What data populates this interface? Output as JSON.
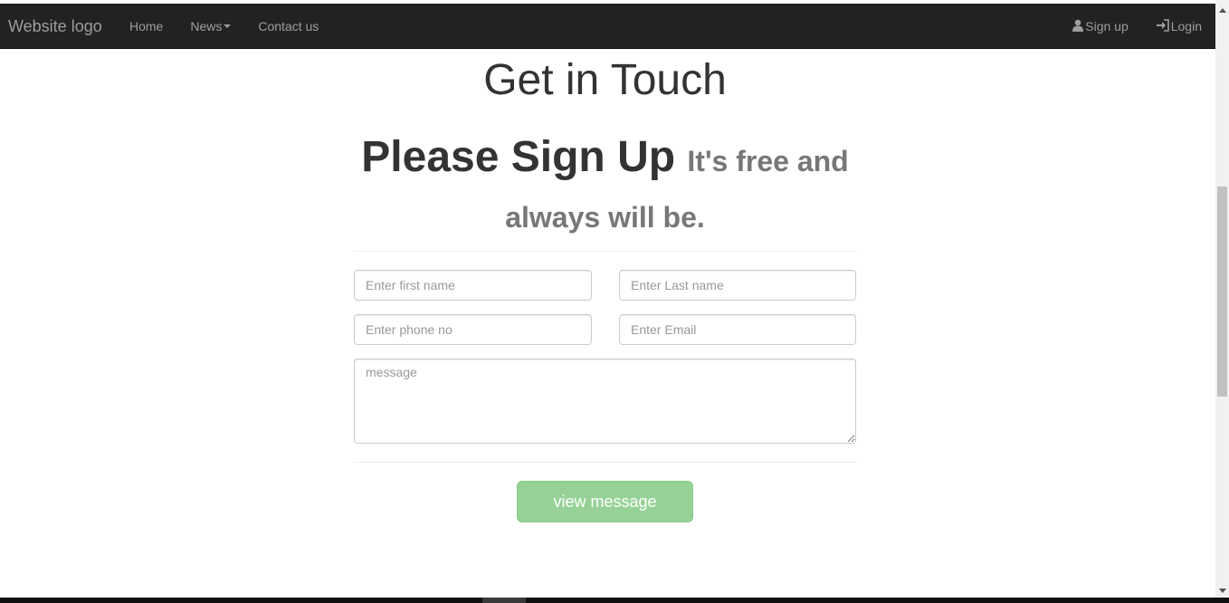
{
  "navbar": {
    "brand": "Website logo",
    "links": [
      {
        "label": "Home"
      },
      {
        "label": "News"
      },
      {
        "label": "Contact us"
      }
    ],
    "right": {
      "signup_label": "Sign up",
      "login_label": "Login"
    },
    "icons": {
      "signup": "user-icon",
      "login": "log-in-icon",
      "news_dropdown": "caret-down-icon"
    }
  },
  "page": {
    "title": "Get in Touch",
    "subtitle_main": "Please Sign Up",
    "subtitle_small": "It's free and always will be."
  },
  "form": {
    "first_name_placeholder": "Enter first name",
    "last_name_placeholder": "Enter Last name",
    "phone_placeholder": "Enter phone no",
    "email_placeholder": "Enter Email",
    "message_placeholder": "message",
    "submit_label": "view message"
  },
  "colors": {
    "navbar_bg": "#222222",
    "nav_text": "#9d9d9d",
    "button_bg": "#96d296",
    "subtitle_small": "#777777"
  }
}
